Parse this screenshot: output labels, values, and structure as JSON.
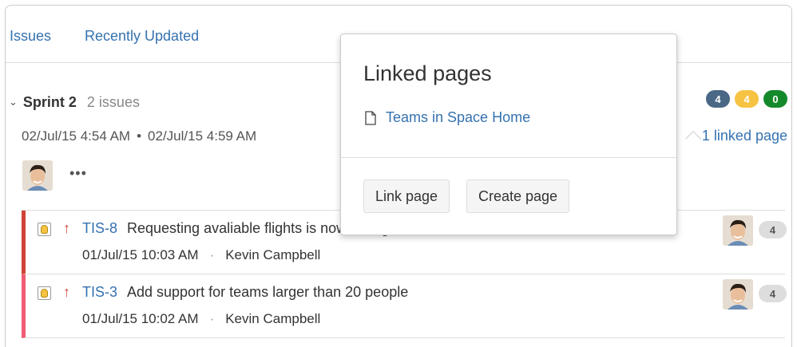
{
  "tabs": [
    {
      "label": "Issues"
    },
    {
      "label": "Recently Updated"
    }
  ],
  "sprint": {
    "name": "Sprint 2",
    "issue_count": "2 issues",
    "badges": [
      {
        "value": "4",
        "color": "#4a6785"
      },
      {
        "value": "4",
        "color": "#f6c342"
      },
      {
        "value": "0",
        "color": "#14892c"
      }
    ],
    "start": "02/Jul/15 4:54 AM",
    "separator": "•",
    "end": "02/Jul/15 4:59 AM",
    "linked_pages_link": "1 linked page",
    "more": "•••"
  },
  "issues": [
    {
      "priority_icon": "↑",
      "key": "TIS-8",
      "summary": "Requesting avaliable flights is now taking",
      "date": "01/Jul/15 10:03 AM",
      "sep": "·",
      "assignee": "Kevin Campbell",
      "count": "4"
    },
    {
      "priority_icon": "↑",
      "key": "TIS-3",
      "summary": "Add support for teams larger than 20 people",
      "date": "01/Jul/15 10:02 AM",
      "sep": "·",
      "assignee": "Kevin Campbell",
      "count": "4"
    }
  ],
  "popup": {
    "title": "Linked pages",
    "page_link": "Teams in Space Home",
    "link_button": "Link page",
    "create_button": "Create page"
  }
}
